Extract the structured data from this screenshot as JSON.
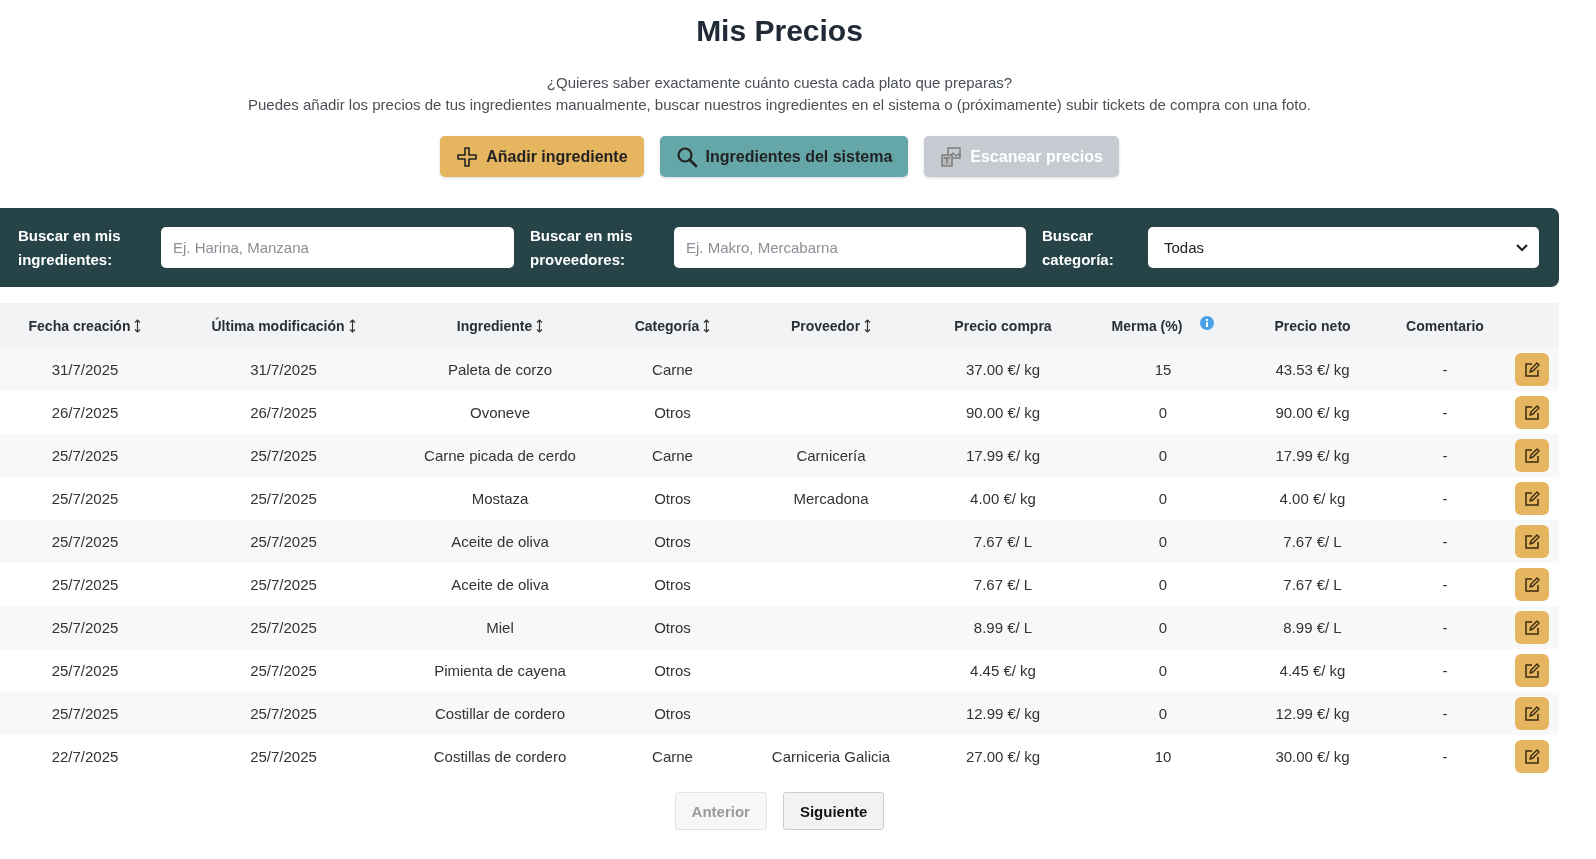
{
  "title": "Mis Precios",
  "intro": [
    "¿Quieres saber exactamente cuánto cuesta cada plato que preparas?",
    "Puedes añadir los precios de tus ingredientes manualmente, buscar nuestros ingredientes en el sistema o (próximamente) subir tickets de compra con una foto."
  ],
  "actions": [
    {
      "label": "Añadir ingrediente",
      "kind": "add",
      "disabled": false
    },
    {
      "label": "Ingredientes del sistema",
      "kind": "search",
      "disabled": false
    },
    {
      "label": "Escanear precios",
      "kind": "scan",
      "disabled": true
    }
  ],
  "filters": [
    {
      "kind": "text",
      "label": "Buscar en mis ingredientes:",
      "placeholder": "Ej. Harina, Manzana"
    },
    {
      "kind": "text",
      "label": "Buscar en mis proveedores:",
      "placeholder": "Ej. Makro, Mercabarna"
    },
    {
      "kind": "select",
      "label": "Buscar categoría:",
      "value": "Todas"
    }
  ],
  "table": {
    "columns": [
      {
        "label": "Fecha creación",
        "kind": "sortable"
      },
      {
        "label": "Última modificación",
        "kind": "sortable"
      },
      {
        "label": "Ingrediente",
        "kind": "sortable"
      },
      {
        "label": "Categoría",
        "kind": "sortable"
      },
      {
        "label": "Proveedor",
        "kind": "sortable"
      },
      {
        "label": "Precio compra",
        "kind": "plain"
      },
      {
        "label": "Merma (%)",
        "kind": "info"
      },
      {
        "label": "Precio neto",
        "kind": "plain"
      },
      {
        "label": "Comentario",
        "kind": "plain"
      }
    ],
    "rows": [
      {
        "cells": [
          "31/7/2025",
          "31/7/2025",
          "Paleta de corzo",
          "Carne",
          "",
          "37.00 €/ kg",
          "15",
          "43.53 €/ kg",
          "-"
        ]
      },
      {
        "cells": [
          "26/7/2025",
          "26/7/2025",
          "Ovoneve",
          "Otros",
          "",
          "90.00 €/ kg",
          "0",
          "90.00 €/ kg",
          "-"
        ]
      },
      {
        "cells": [
          "25/7/2025",
          "25/7/2025",
          "Carne picada de cerdo",
          "Carne",
          "Carnicería",
          "17.99 €/ kg",
          "0",
          "17.99 €/ kg",
          "-"
        ]
      },
      {
        "cells": [
          "25/7/2025",
          "25/7/2025",
          "Mostaza",
          "Otros",
          "Mercadona",
          "4.00 €/ kg",
          "0",
          "4.00 €/ kg",
          "-"
        ]
      },
      {
        "cells": [
          "25/7/2025",
          "25/7/2025",
          "Aceite de oliva",
          "Otros",
          "",
          "7.67 €/ L",
          "0",
          "7.67 €/ L",
          "-"
        ]
      },
      {
        "cells": [
          "25/7/2025",
          "25/7/2025",
          "Aceite de oliva",
          "Otros",
          "",
          "7.67 €/ L",
          "0",
          "7.67 €/ L",
          "-"
        ]
      },
      {
        "cells": [
          "25/7/2025",
          "25/7/2025",
          "Miel",
          "Otros",
          "",
          "8.99 €/ L",
          "0",
          "8.99 €/ L",
          "-"
        ]
      },
      {
        "cells": [
          "25/7/2025",
          "25/7/2025",
          "Pimienta de cayena",
          "Otros",
          "",
          "4.45 €/ kg",
          "0",
          "4.45 €/ kg",
          "-"
        ]
      },
      {
        "cells": [
          "25/7/2025",
          "25/7/2025",
          "Costillar de cordero",
          "Otros",
          "",
          "12.99 €/ kg",
          "0",
          "12.99 €/ kg",
          "-"
        ]
      },
      {
        "cells": [
          "22/7/2025",
          "25/7/2025",
          "Costillas de cordero",
          "Carne",
          "Carniceria Galicia",
          "27.00 €/ kg",
          "10",
          "30.00 €/ kg",
          "-"
        ]
      }
    ]
  },
  "pagination": [
    {
      "label": "Anterior",
      "disabled": true
    },
    {
      "label": "Siguiente",
      "disabled": false
    }
  ]
}
